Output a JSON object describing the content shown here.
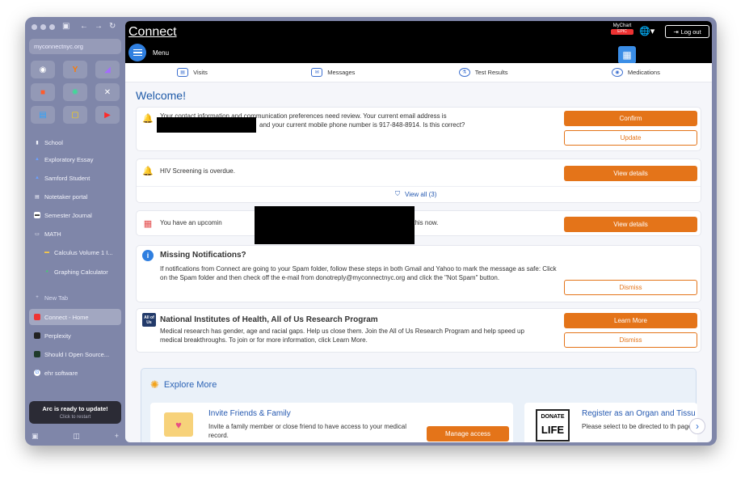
{
  "browser": {
    "url": "myconnectnyc.org",
    "folders": {
      "school": "School",
      "math": "MATH"
    },
    "items": [
      {
        "label": "Exploratory Essay",
        "icon": "doc-icon"
      },
      {
        "label": "Samford Student",
        "icon": "doc-icon"
      },
      {
        "label": "Notetaker portal",
        "icon": "doc-icon"
      },
      {
        "label": "Semester Journal",
        "icon": "journal-icon"
      },
      {
        "label": "Calculus Volume 1 I...",
        "icon": "book-icon"
      },
      {
        "label": "Graphing Calculator",
        "icon": "calculator-icon"
      }
    ],
    "new_tab": "New Tab",
    "tabs": [
      {
        "label": "Connect - Home",
        "active": true
      },
      {
        "label": "Perplexity",
        "active": false
      },
      {
        "label": "Should I Open Source...",
        "active": false
      },
      {
        "label": "ehr software",
        "active": false
      }
    ],
    "update_title": "Arc is ready to update!",
    "update_sub": "Click to restart"
  },
  "header": {
    "logo": "Connect",
    "menu": "Menu",
    "mychart": "MyChart",
    "mychart_brand": "EPIC",
    "logout": "Log out"
  },
  "nav": {
    "visits": "Visits",
    "messages": "Messages",
    "test_results": "Test Results",
    "medications": "Medications"
  },
  "welcome": "Welcome!",
  "cards": {
    "contact": {
      "text1": "Your contact information and communication preferences need review. Your current email address is",
      "text2": "and your current mobile phone number is 917-848-8914. Is this correct?",
      "confirm": "Confirm",
      "update": "Update"
    },
    "hiv": {
      "text": "HIV Screening is overdue.",
      "btn": "View details",
      "view_all": "View all (3)"
    },
    "upcoming": {
      "text_a": "You have an upcomin",
      "text_b": "mplete this now.",
      "btn": "View details"
    },
    "missing": {
      "title": "Missing Notifications?",
      "text": "If notifications from Connect are going to your Spam folder, follow these steps in both Gmail and Yahoo to mark the message as safe: Click on the Spam folder and then check off the e-mail from donotreply@myconnectnyc.org and click the \"Not Spam\" button.",
      "btn": "Dismiss"
    },
    "nih": {
      "title": "National Institutes of Health, All of Us Research Program",
      "text": "Medical research has gender, age and racial gaps. Help us close them. Join the All of Us Research Program and help speed up medical breakthroughs. To join or for more information, click Learn More.",
      "learn": "Learn More",
      "dismiss": "Dismiss",
      "logo": "All of Us"
    }
  },
  "explore": {
    "title": "Explore More",
    "invite": {
      "title": "Invite Friends & Family",
      "text": "Invite a family member or close friend to have access to your medical record.",
      "btn": "Manage access"
    },
    "organ": {
      "title": "Register as an Organ and Tissu",
      "text": "Please select to be directed to th page",
      "logo_top": "DONATE",
      "logo_bottom": "LIFE"
    }
  },
  "colors": {
    "accent": "#e47419",
    "link": "#1e5aa8",
    "sidebar": "#7f86a9"
  }
}
